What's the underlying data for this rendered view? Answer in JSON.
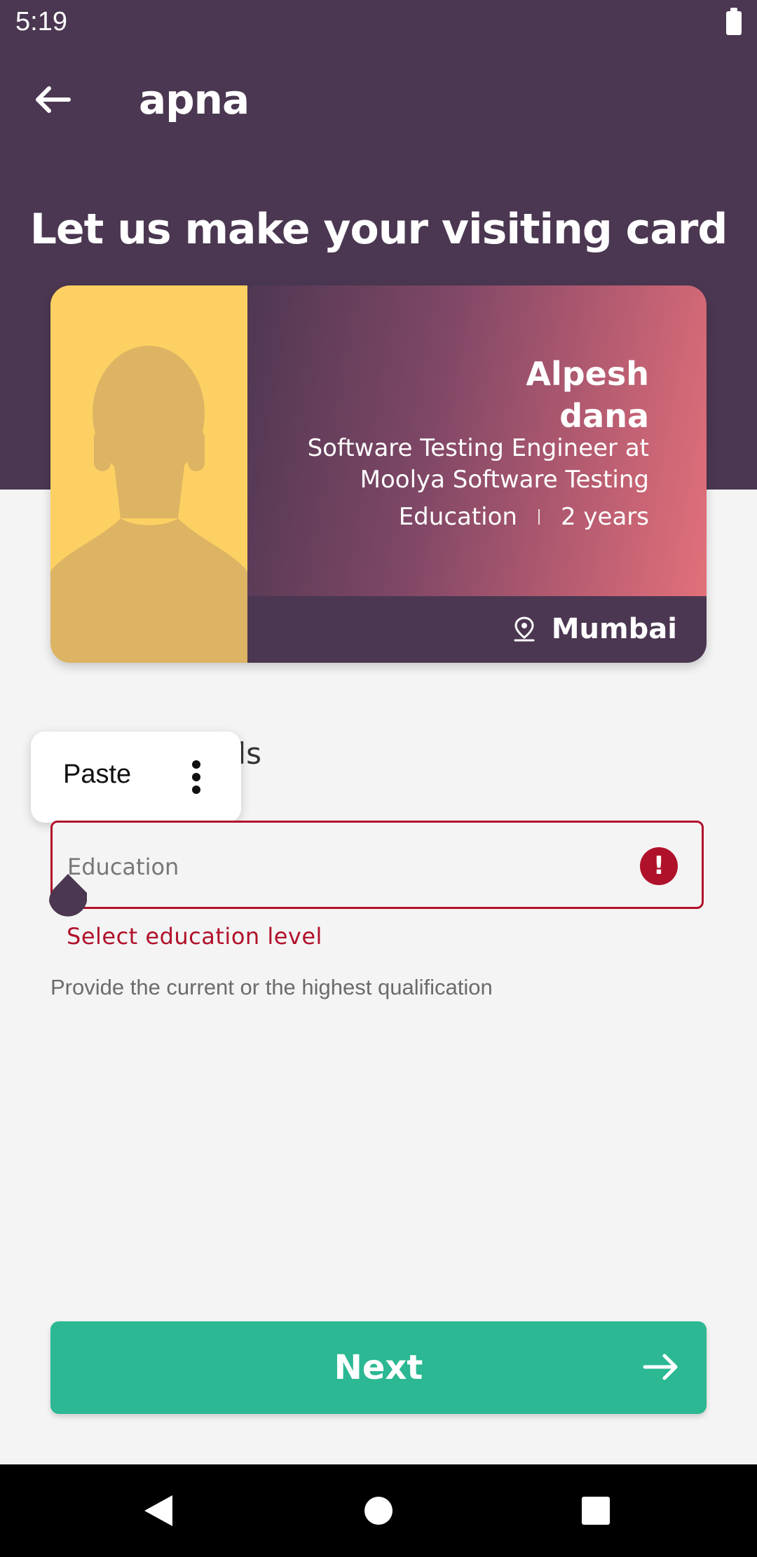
{
  "status_bar": {
    "time": "5:19"
  },
  "header": {
    "app_name": "apna",
    "headline": "Let us make your visiting card"
  },
  "card": {
    "name_line1": "Alpesh",
    "name_line2": "dana",
    "role_line1": "Software Testing Engineer at",
    "role_line2": "Moolya Software Testing",
    "education": "Education",
    "experience": "2 years",
    "city": "Mumbai"
  },
  "form": {
    "section_title_visible": "ails",
    "education_label": "Education",
    "error_message": "Select education level",
    "helper_text": "Provide the current or the highest qualification"
  },
  "context_menu": {
    "paste_label": "Paste"
  },
  "footer": {
    "next_label": "Next"
  },
  "colors": {
    "brand_purple": "#4b3751",
    "accent_green": "#2bb893",
    "error_red": "#b0112a",
    "photo_yellow": "#fdd063"
  }
}
